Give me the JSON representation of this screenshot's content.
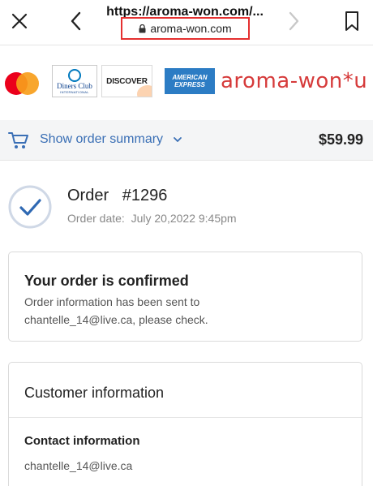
{
  "browser": {
    "page_title": "https://aroma-won.com/...",
    "domain": "aroma-won.com",
    "icons": [
      "close-icon",
      "back-icon",
      "forward-icon",
      "bookmark-icon",
      "lock-icon"
    ]
  },
  "payment_strip": {
    "cards": [
      "mastercard",
      "diners-club",
      "discover",
      "american-express"
    ],
    "diners_label": "Diners Club",
    "diners_sub": "INTERNATIONAL",
    "discover_label": "DISCOVER",
    "amex_line1": "AMERICAN",
    "amex_line2": "EXPRESS",
    "brand_text": "aroma-won*u"
  },
  "summary": {
    "toggle_label": "Show order summary",
    "total": "$59.99"
  },
  "order": {
    "title": "Order   #1296",
    "date": "Order date:  July 20,2022 9:45pm"
  },
  "confirmation": {
    "heading": "Your order is confirmed",
    "line1": "Order information has been sent to",
    "line2": "chantelle_14@live.ca, please check."
  },
  "customer": {
    "heading": "Customer information",
    "contact_label": "Contact information",
    "contact_email": "chantelle_14@live.ca"
  },
  "colors": {
    "accent": "#3a6fb5",
    "highlight_box": "#e53030",
    "brand_red": "#d63b3b"
  }
}
